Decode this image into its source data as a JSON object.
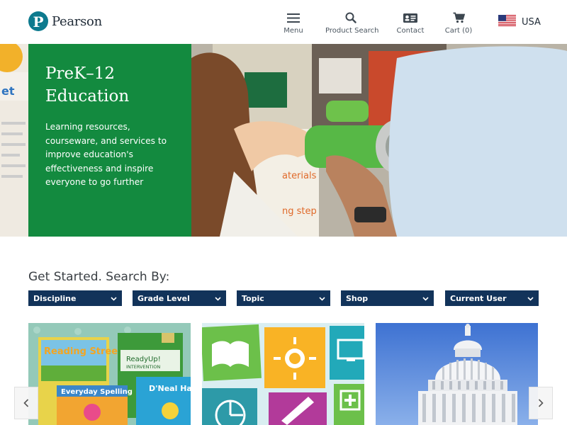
{
  "brand": {
    "name": "Pearson",
    "logo_letter": "P",
    "color": "#0d7a8e"
  },
  "nav": {
    "menu": {
      "label": "Menu",
      "icon": "hamburger-icon"
    },
    "search": {
      "label": "Product Search",
      "icon": "search-icon"
    },
    "contact": {
      "label": "Contact",
      "icon": "contact-card-icon"
    },
    "cart": {
      "label": "Cart (0)",
      "icon": "cart-icon"
    },
    "region": {
      "label": "USA",
      "icon": "us-flag-icon"
    }
  },
  "hero": {
    "title_line1": "PreK–12",
    "title_line2": "Education",
    "body": "Learning resources, courseware, and services to improve education's effectiveness and inspire everyone to go further",
    "panel_color": "#138a3f"
  },
  "search_by": {
    "heading": "Get Started. Search By:",
    "dropdowns": [
      "Discipline",
      "Grade Level",
      "Topic",
      "Shop",
      "Current User"
    ],
    "color": "#12335a"
  },
  "cards": {
    "products": {
      "book1_title": "Reading Street",
      "book2_title": "ReadyUp!",
      "book2_subtitle": "INTERVENTION",
      "book3_title": "Everyday Spelling",
      "book4_title": "D'Neal Handwriting"
    },
    "subjects": {
      "icons": [
        "book-icon",
        "sun-icon",
        "monitor-icon",
        "pie-chart-icon",
        "pencil-icon",
        "plus-icon"
      ]
    },
    "government": {
      "image": "capitol-dome"
    }
  },
  "carousel": {
    "prev_icon": "chevron-left-icon",
    "next_icon": "chevron-right-icon"
  }
}
